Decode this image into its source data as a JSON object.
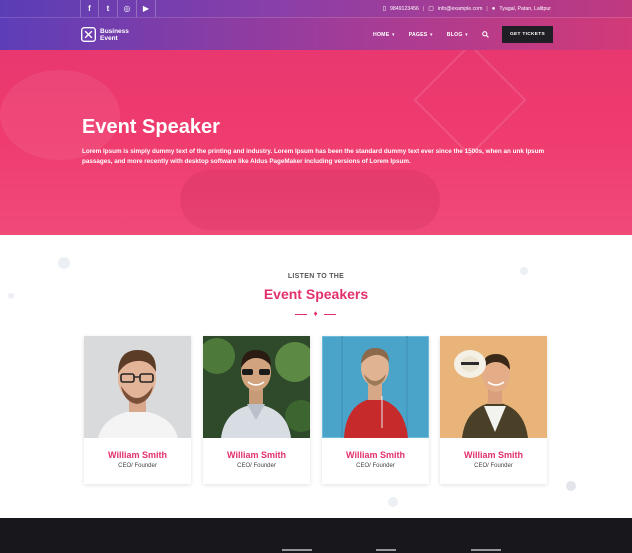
{
  "topbar": {
    "social": [
      {
        "icon": "facebook-icon",
        "glyph": "f"
      },
      {
        "icon": "twitter-icon",
        "glyph": "t"
      },
      {
        "icon": "instagram-icon",
        "glyph": "◎"
      },
      {
        "icon": "youtube-icon",
        "glyph": "▶"
      }
    ],
    "phone": "9849123456",
    "email": "info@example.com",
    "address": "Tyagal, Patan, Lalitpur"
  },
  "header": {
    "logo_line1": "Business",
    "logo_line2": "Event",
    "nav": [
      {
        "label": "HOME"
      },
      {
        "label": "PAGES"
      },
      {
        "label": "BLOG"
      }
    ],
    "cta": "GET TICKETS"
  },
  "hero": {
    "title": "Event Speaker",
    "text": "Lorem Ipsum is simply dummy text of the printing and industry. Lorem Ipsum has been the standard dummy text ever since the 1500s, when an unk Ipsum passages, and more recently with desktop software like Aldus PageMaker including versions of Lorem Ipsum."
  },
  "speakers": {
    "eyebrow": "LISTEN TO THE",
    "title": "Event Speakers",
    "cards": [
      {
        "name": "William Smith",
        "role": "CEO/ Founder"
      },
      {
        "name": "William Smith",
        "role": "CEO/ Founder"
      },
      {
        "name": "William Smith",
        "role": "CEO/ Founder"
      },
      {
        "name": "William Smith",
        "role": "CEO/ Founder"
      }
    ]
  },
  "colors": {
    "accent": "#e3306d",
    "footer": "#17171c",
    "cta_bg": "#1e1e24"
  }
}
